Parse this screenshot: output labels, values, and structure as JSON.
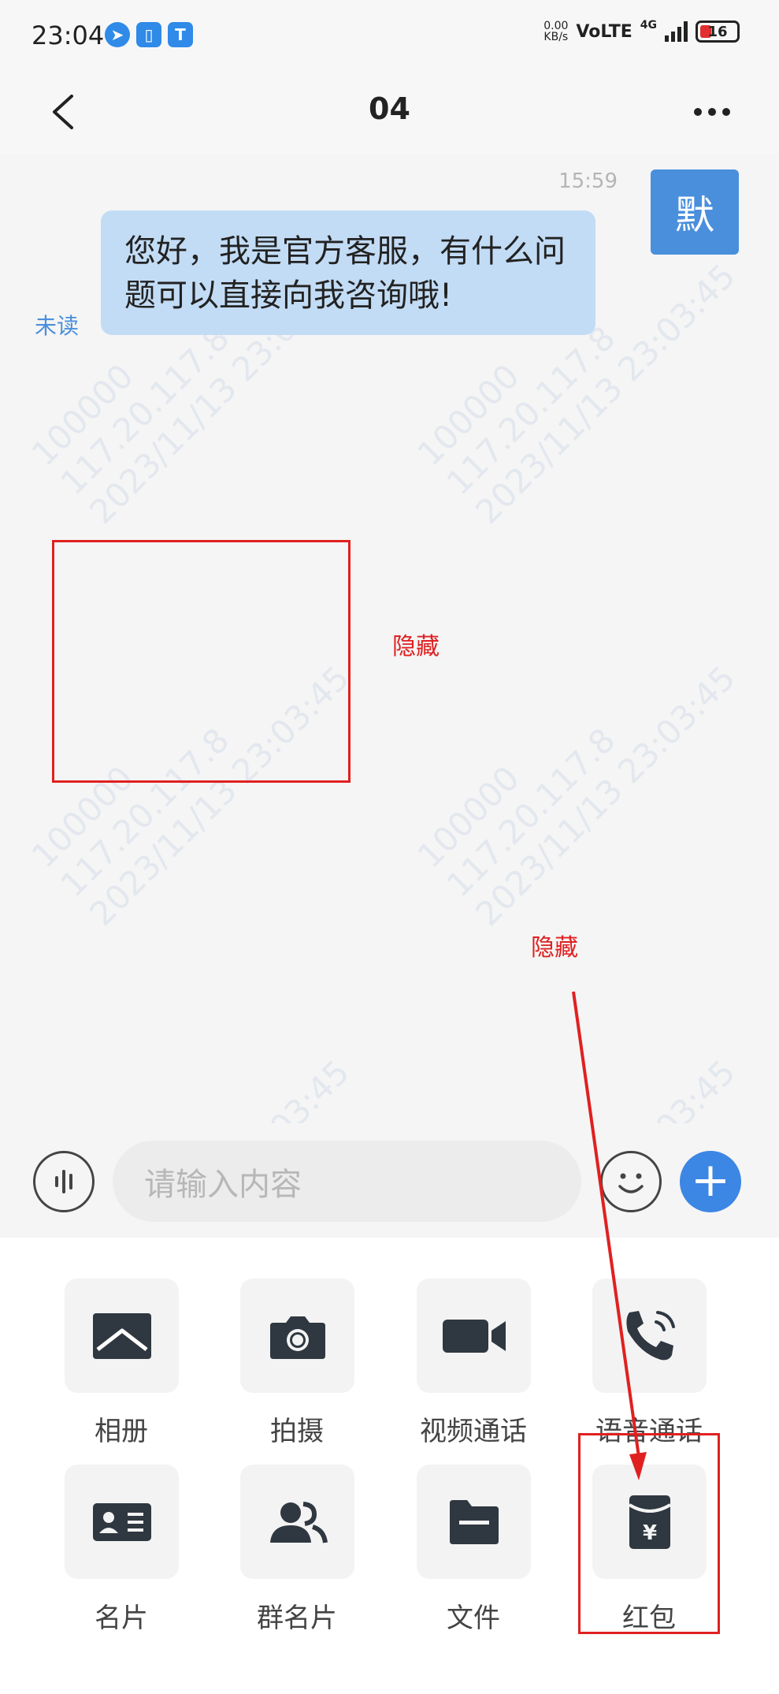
{
  "status_bar": {
    "time": "23:04",
    "network_speed_value": "0.00",
    "network_speed_unit": "KB/s",
    "volte": "VoLTE",
    "network_type": "4G",
    "battery": "16"
  },
  "nav": {
    "title": "04"
  },
  "chat": {
    "watermark_lines": [
      "100000",
      "117.20.117.8",
      "2023/11/13 23:03:45"
    ],
    "message": {
      "time": "15:59",
      "avatar_text": "默",
      "text_line1": "您好，我是官方客服，有什么问",
      "text_line2": "题可以直接向我咨询哦!",
      "status": "未读"
    },
    "annotations": {
      "hidden_label_1": "隐藏",
      "hidden_label_2": "隐藏"
    }
  },
  "input": {
    "placeholder": "请输入内容"
  },
  "panel": {
    "items": [
      {
        "label": "相册",
        "icon": "album-icon"
      },
      {
        "label": "拍摄",
        "icon": "camera-icon"
      },
      {
        "label": "视频通话",
        "icon": "video-call-icon"
      },
      {
        "label": "语音通话",
        "icon": "voice-call-icon"
      },
      {
        "label": "名片",
        "icon": "business-card-icon"
      },
      {
        "label": "群名片",
        "icon": "group-card-icon"
      },
      {
        "label": "文件",
        "icon": "file-icon"
      },
      {
        "label": "红包",
        "icon": "red-packet-icon"
      }
    ]
  },
  "colors": {
    "accent": "#3c86e4",
    "bubble": "#c3dcf5",
    "annotation": "#e02020",
    "icon_dark": "#2f3740"
  }
}
